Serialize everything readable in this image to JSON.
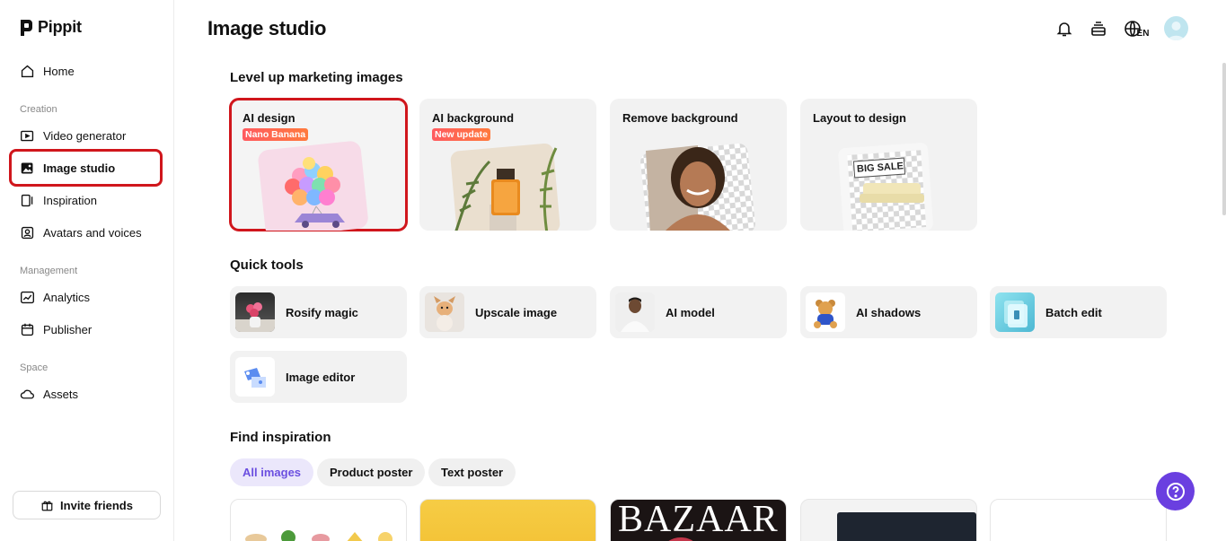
{
  "app": {
    "name": "Pippit"
  },
  "sidebar": {
    "home": "Home",
    "sections": {
      "creation": "Creation",
      "management": "Management",
      "space": "Space"
    },
    "items": {
      "video_generator": "Video generator",
      "image_studio": "Image studio",
      "inspiration": "Inspiration",
      "avatars_voices": "Avatars and voices",
      "analytics": "Analytics",
      "publisher": "Publisher",
      "assets": "Assets"
    },
    "invite": "Invite friends"
  },
  "header": {
    "title": "Image studio",
    "language": "EN"
  },
  "level_up": {
    "title": "Level up marketing images",
    "cards": [
      {
        "title": "AI design",
        "badge": "Nano Banana"
      },
      {
        "title": "AI background",
        "badge": "New update"
      },
      {
        "title": "Remove background"
      },
      {
        "title": "Layout to design",
        "sale_text": "BIG SALE"
      }
    ]
  },
  "quick_tools": {
    "title": "Quick tools",
    "items": [
      "Rosify magic",
      "Upscale image",
      "AI model",
      "AI shadows",
      "Batch edit",
      "Image editor"
    ]
  },
  "find_inspiration": {
    "title": "Find inspiration",
    "chips": [
      "All images",
      "Product poster",
      "Text poster"
    ],
    "active_chip": "All images",
    "thumb_text": "BAZAAR"
  },
  "colors": {
    "accent": "#6a3fe0",
    "highlight": "#d0161c",
    "badge": "#ff5a5f"
  }
}
